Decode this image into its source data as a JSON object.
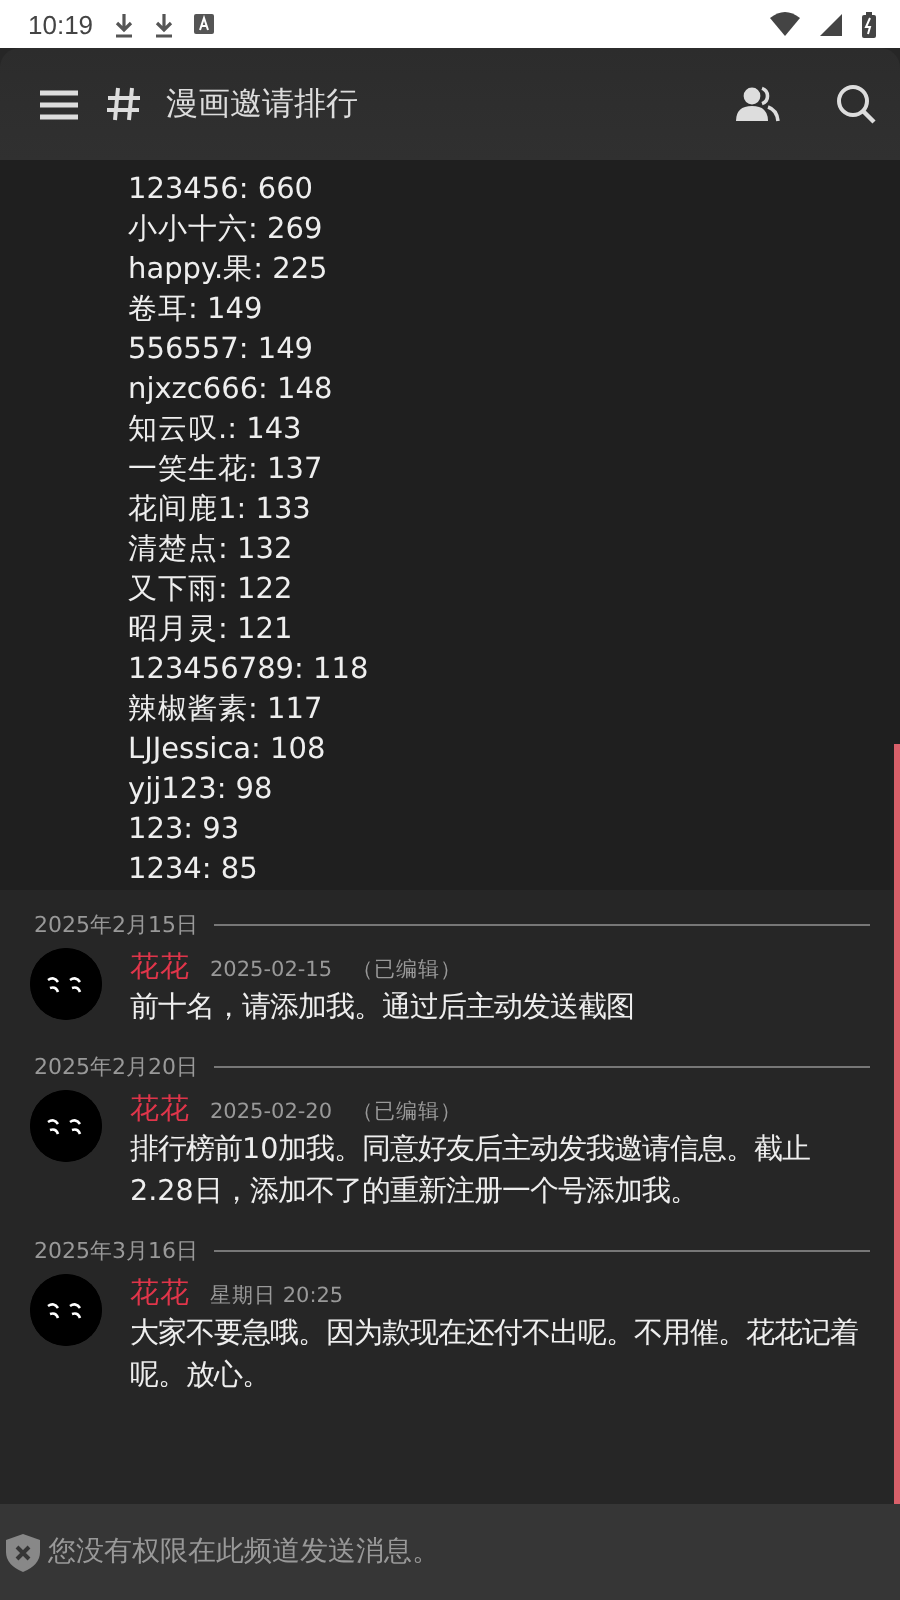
{
  "status_bar": {
    "time": "10:19"
  },
  "header": {
    "channel": "漫画邀请排行"
  },
  "leaderboard": [
    "123456: 660",
    "小小十六: 269",
    "happy.果: 225",
    "卷耳: 149",
    "556557: 149",
    "njxzc666: 148",
    "知云叹.: 143",
    "一笑生花: 137",
    "花间鹿1: 133",
    "清楚点: 132",
    "又下雨: 122",
    "昭月灵: 121",
    "123456789: 118",
    "辣椒酱素: 117",
    "LJJessica: 108",
    "yjj123: 98",
    "123: 93",
    "1234: 85"
  ],
  "messages": [
    {
      "date": "2025年2月15日",
      "author": "花花",
      "time": "2025-02-15",
      "edited": "（已编辑）",
      "text": "前十名，请添加我。通过后主动发送截图"
    },
    {
      "date": "2025年2月20日",
      "author": "花花",
      "time": "2025-02-20",
      "edited": "（已编辑）",
      "text": "排行榜前10加我。同意好友后主动发我邀请信息。截止2.28日，添加不了的重新注册一个号添加我。"
    },
    {
      "date": "2025年3月16日",
      "author": "花花",
      "time": "星期日 20:25",
      "text": "大家不要急哦。因为款现在还付不出呢。不用催。花花记着呢。放心。"
    }
  ],
  "footer": {
    "notice": "您没有权限在此频道发送消息。"
  }
}
